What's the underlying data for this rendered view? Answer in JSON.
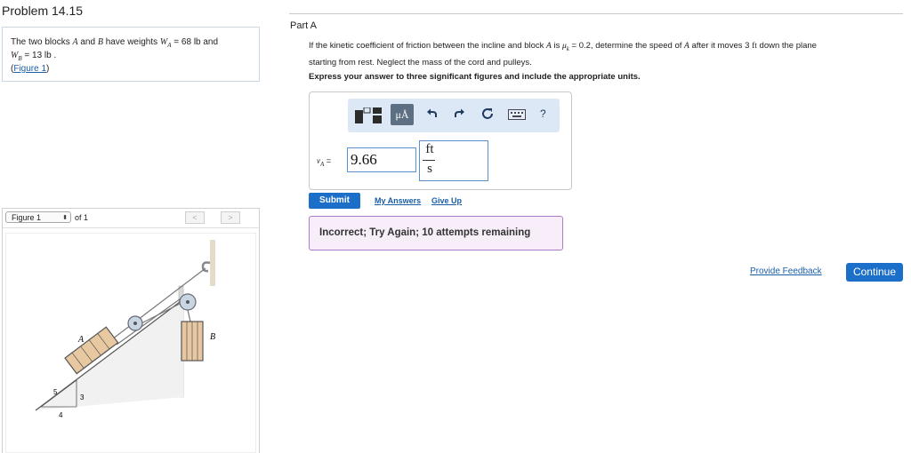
{
  "problem": {
    "title": "Problem 14.15",
    "text_1": "The two blocks ",
    "block_a": "A",
    "text_2": " and ",
    "block_b": "B",
    "text_3": " have weights ",
    "wa_sym": "W",
    "wa_sub": "A",
    "wa_val": " = 68 lb and",
    "wb_sym": "W",
    "wb_sub": "B",
    "wb_val": " = 13 lb .",
    "figure_link": "Figure 1",
    "paren_open": "(",
    "paren_close": ")"
  },
  "figure_panel": {
    "select_label": "Figure 1",
    "of_label": "of 1",
    "prev": "<",
    "next": ">",
    "label_a": "A",
    "label_b": "B",
    "slope_5": "5",
    "slope_3": "3",
    "slope_4": "4"
  },
  "part_a": {
    "title": "Part A",
    "question_1": "If the kinetic coefficient of friction between the incline and block ",
    "q_a": "A",
    "question_2": " is ",
    "q_mu": "μ",
    "q_mu_sub": "k",
    "question_3": " = 0.2, determine the speed of ",
    "q_a2": "A",
    "question_4": " after it moves 3 ",
    "q_ft": "ft",
    "question_5": " down the plane",
    "question_line2": "starting from rest. Neglect the mass of the cord and pulleys.",
    "instruction": "Express your answer to three significant figures and include the appropriate units."
  },
  "toolbar": {
    "template_icon": "templates-icon",
    "units_label": "μÅ",
    "undo_icon": "undo-icon",
    "redo_icon": "redo-icon",
    "reset_icon": "reset-icon",
    "keyboard_icon": "keyboard-icon",
    "help_label": "?"
  },
  "answer": {
    "var": "v",
    "var_sub": "A",
    "equals": " =",
    "value": "9.66",
    "unit_num": "ft",
    "unit_den": "s"
  },
  "actions": {
    "submit": "Submit",
    "my_answers": "My Answers",
    "give_up": "Give Up"
  },
  "feedback": {
    "message": "Incorrect; Try Again; 10 attempts remaining"
  },
  "footer": {
    "provide_feedback": "Provide Feedback",
    "continue": "Continue"
  },
  "colors": {
    "accent": "#1c6fc9",
    "toolbar_bg": "#dce8f6",
    "feedback_bg": "#f7eefa",
    "feedback_border": "#b07acb",
    "link": "#1a5ea8"
  }
}
